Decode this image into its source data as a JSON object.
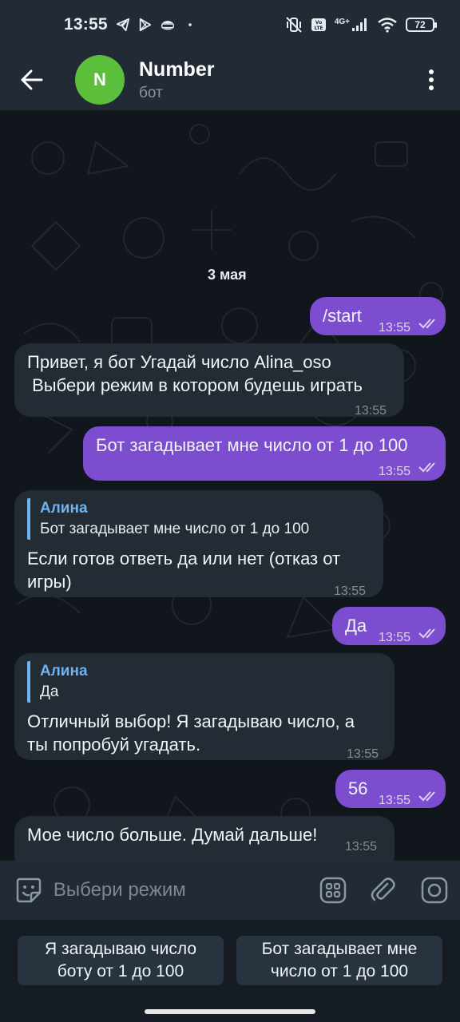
{
  "status_bar": {
    "time": "13:55",
    "battery": "72",
    "network": "4G+"
  },
  "header": {
    "avatar_letter": "N",
    "title": "Number",
    "subtitle": "бот"
  },
  "chat": {
    "date": "3 мая",
    "messages": [
      {
        "from": "out",
        "text": "/start",
        "time": "13:55"
      },
      {
        "from": "in",
        "line1": "Привет, я бот Угадай число Alina_oso",
        "line2": " Выбери режим в котором будешь играть",
        "time": "13:55"
      },
      {
        "from": "out",
        "text": "Бот загадывает мне число от 1 до 100",
        "time": "13:55"
      },
      {
        "from": "in",
        "reply_name": "Алина",
        "reply_text": "Бот загадывает мне число от 1 до 100",
        "line1": "Если готов ответь да или нет (отказ от",
        "line2": "игры)",
        "time": "13:55"
      },
      {
        "from": "out",
        "text": "Да",
        "time": "13:55"
      },
      {
        "from": "in",
        "reply_name": "Алина",
        "reply_text": "Да",
        "line1": "Отличный выбор! Я загадываю число, а",
        "line2": "ты попробуй угадать.",
        "time": "13:55"
      },
      {
        "from": "out",
        "text": "56",
        "time": "13:55"
      },
      {
        "from": "in",
        "text": "Мое число больше. Думай дальше!",
        "time": "13:55"
      }
    ]
  },
  "input": {
    "placeholder": "Выбери режим",
    "value": ""
  },
  "keyboard": {
    "buttons": [
      {
        "line1": "Я загадываю число",
        "line2": "боту от 1 до 100"
      },
      {
        "line1": "Бот загадывает мне",
        "line2": "число от 1 до 100"
      }
    ]
  },
  "colors": {
    "outgoing_bubble": "#7c4dcf",
    "incoming_bubble": "#232b34",
    "reply_accent": "#6fb3f2",
    "avatar": "#5cbf3c"
  }
}
